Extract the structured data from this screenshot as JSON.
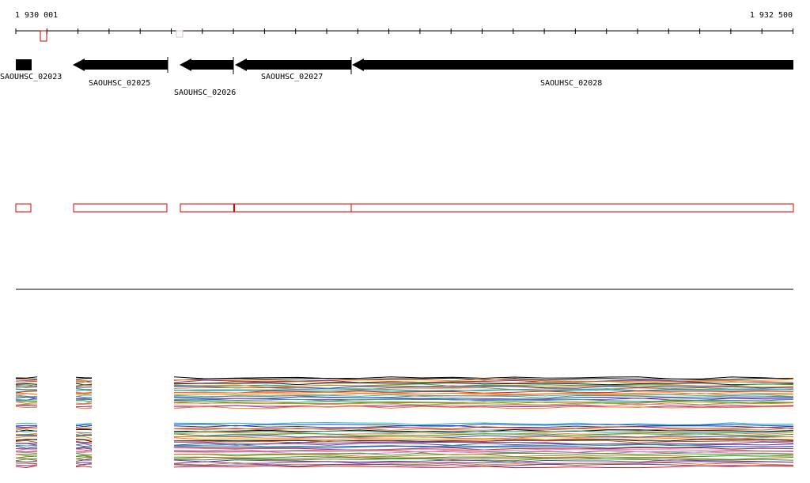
{
  "ruler": {
    "start_label": "1 930 001",
    "end_label": "1 932 500"
  },
  "genes": [
    {
      "id": "g1",
      "label": "SAOUHSC_02023",
      "strand": "+"
    },
    {
      "id": "g2",
      "label": "SAOUHSC_02025",
      "strand": "-"
    },
    {
      "id": "g3",
      "label": "SAOUHSC_02026",
      "strand": "-"
    },
    {
      "id": "g4",
      "label": "SAOUHSC_02027",
      "strand": "-"
    },
    {
      "id": "g5",
      "label": "SAOUHSC_02028",
      "strand": "-"
    }
  ],
  "colors": {
    "gene_fill": "#000000",
    "annotation_outline": "#dd0000",
    "track_palette": [
      "#000000",
      "#1f3fbf",
      "#d11f1f",
      "#2fa82f",
      "#c87d1f",
      "#7d2f9f",
      "#1f9f9f",
      "#9f9f1f",
      "#ff7f0e",
      "#8c564b",
      "#e377c2",
      "#7f7f7f",
      "#bcbd22",
      "#17becf",
      "#6a3d9a",
      "#b15928",
      "#33a02c",
      "#e31a1c"
    ]
  }
}
